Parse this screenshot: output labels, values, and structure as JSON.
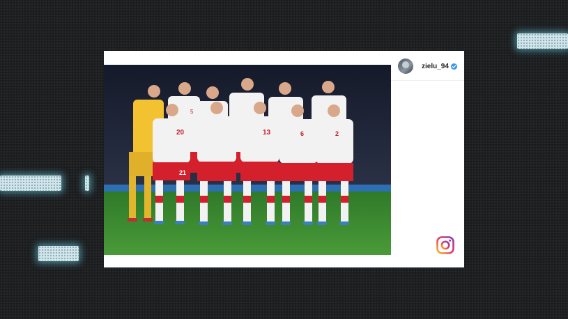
{
  "post": {
    "username": "zielu_94",
    "verified": true,
    "image_subject": "team-photo",
    "shirt_numbers": [
      "5",
      "20",
      "21",
      "13",
      "6",
      "2"
    ]
  },
  "icons": {
    "verified_badge": "verified-badge-icon",
    "platform_logo": "instagram-icon"
  },
  "colors": {
    "background": "#1b1d1f",
    "glow": "#6fdcf0",
    "card": "#ffffff",
    "verified": "#3897f0",
    "pitch": "#3f8a2e",
    "shirt": "#f2f2f2",
    "shorts": "#d3202c",
    "keeper": "#f2c230"
  }
}
